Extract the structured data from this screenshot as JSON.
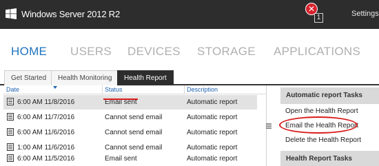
{
  "window": {
    "title": "Windows Server 2012 R2",
    "alert_count": "1",
    "settings_label": "Settings"
  },
  "nav": {
    "items": [
      {
        "label": "HOME",
        "active": true
      },
      {
        "label": "USERS",
        "active": false
      },
      {
        "label": "DEVICES",
        "active": false
      },
      {
        "label": "STORAGE",
        "active": false
      },
      {
        "label": "APPLICATIONS",
        "active": false
      }
    ]
  },
  "tabs": [
    {
      "label": "Get Started",
      "active": false
    },
    {
      "label": "Health Monitoring",
      "active": false
    },
    {
      "label": "Health Report",
      "active": true
    }
  ],
  "grid": {
    "columns": [
      "Date",
      "Status",
      "Description"
    ],
    "rows": [
      {
        "date": "6:00 AM 11/8/2016",
        "status": "Email sent",
        "description": "Automatic report",
        "selected": true
      },
      {
        "date": "6:00 AM 11/7/2016",
        "status": "Cannot send email",
        "description": "Automatic report",
        "selected": false
      },
      {
        "date": "6:00 AM 11/6/2016",
        "status": "Cannot send email",
        "description": "Automatic report",
        "selected": false
      },
      {
        "date": "1:00 AM 11/6/2016",
        "status": "Cannot send email",
        "description": "Automatic report",
        "selected": false
      },
      {
        "date": "6:00 AM 11/5/2016",
        "status": "Email sent",
        "description": "Automatic report",
        "selected": false
      }
    ]
  },
  "tasks": {
    "automatic_heading": "Automatic report Tasks",
    "items": [
      {
        "label": "Open the Health Report"
      },
      {
        "label": "Email the Health Report"
      },
      {
        "label": "Delete the Health Report"
      }
    ],
    "health_heading": "Health Report Tasks"
  },
  "colors": {
    "accent": "#1e73be",
    "topbar": "#2d2d2d",
    "highlight_red": "#d91c1c"
  }
}
